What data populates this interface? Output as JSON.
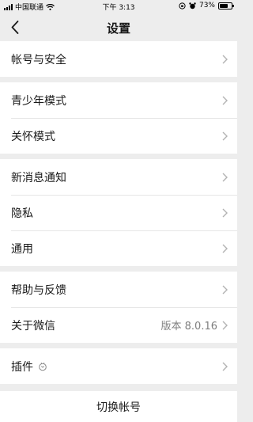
{
  "status_bar": {
    "carrier": "中国联通",
    "time": "下午 3:13",
    "battery_percent_label": "73%",
    "battery_level": 0.73
  },
  "nav": {
    "title": "设置",
    "back_icon": "chevron-left-icon"
  },
  "groups": [
    {
      "items": [
        {
          "label": "帐号与安全"
        }
      ]
    },
    {
      "items": [
        {
          "label": "青少年模式"
        },
        {
          "label": "关怀模式"
        }
      ]
    },
    {
      "items": [
        {
          "label": "新消息通知"
        },
        {
          "label": "隐私"
        },
        {
          "label": "通用"
        }
      ]
    },
    {
      "items": [
        {
          "label": "帮助与反馈"
        },
        {
          "label": "关于微信",
          "value": "版本 8.0.16"
        }
      ]
    },
    {
      "items": [
        {
          "label": "插件",
          "icon": "plugin-icon"
        }
      ]
    }
  ],
  "switch_account": {
    "label": "切换帐号"
  },
  "colors": {
    "background": "#ededed",
    "cell": "#ffffff",
    "text": "#191919",
    "secondary_text": "#7f7f7f",
    "chevron": "#b2b2b2"
  }
}
